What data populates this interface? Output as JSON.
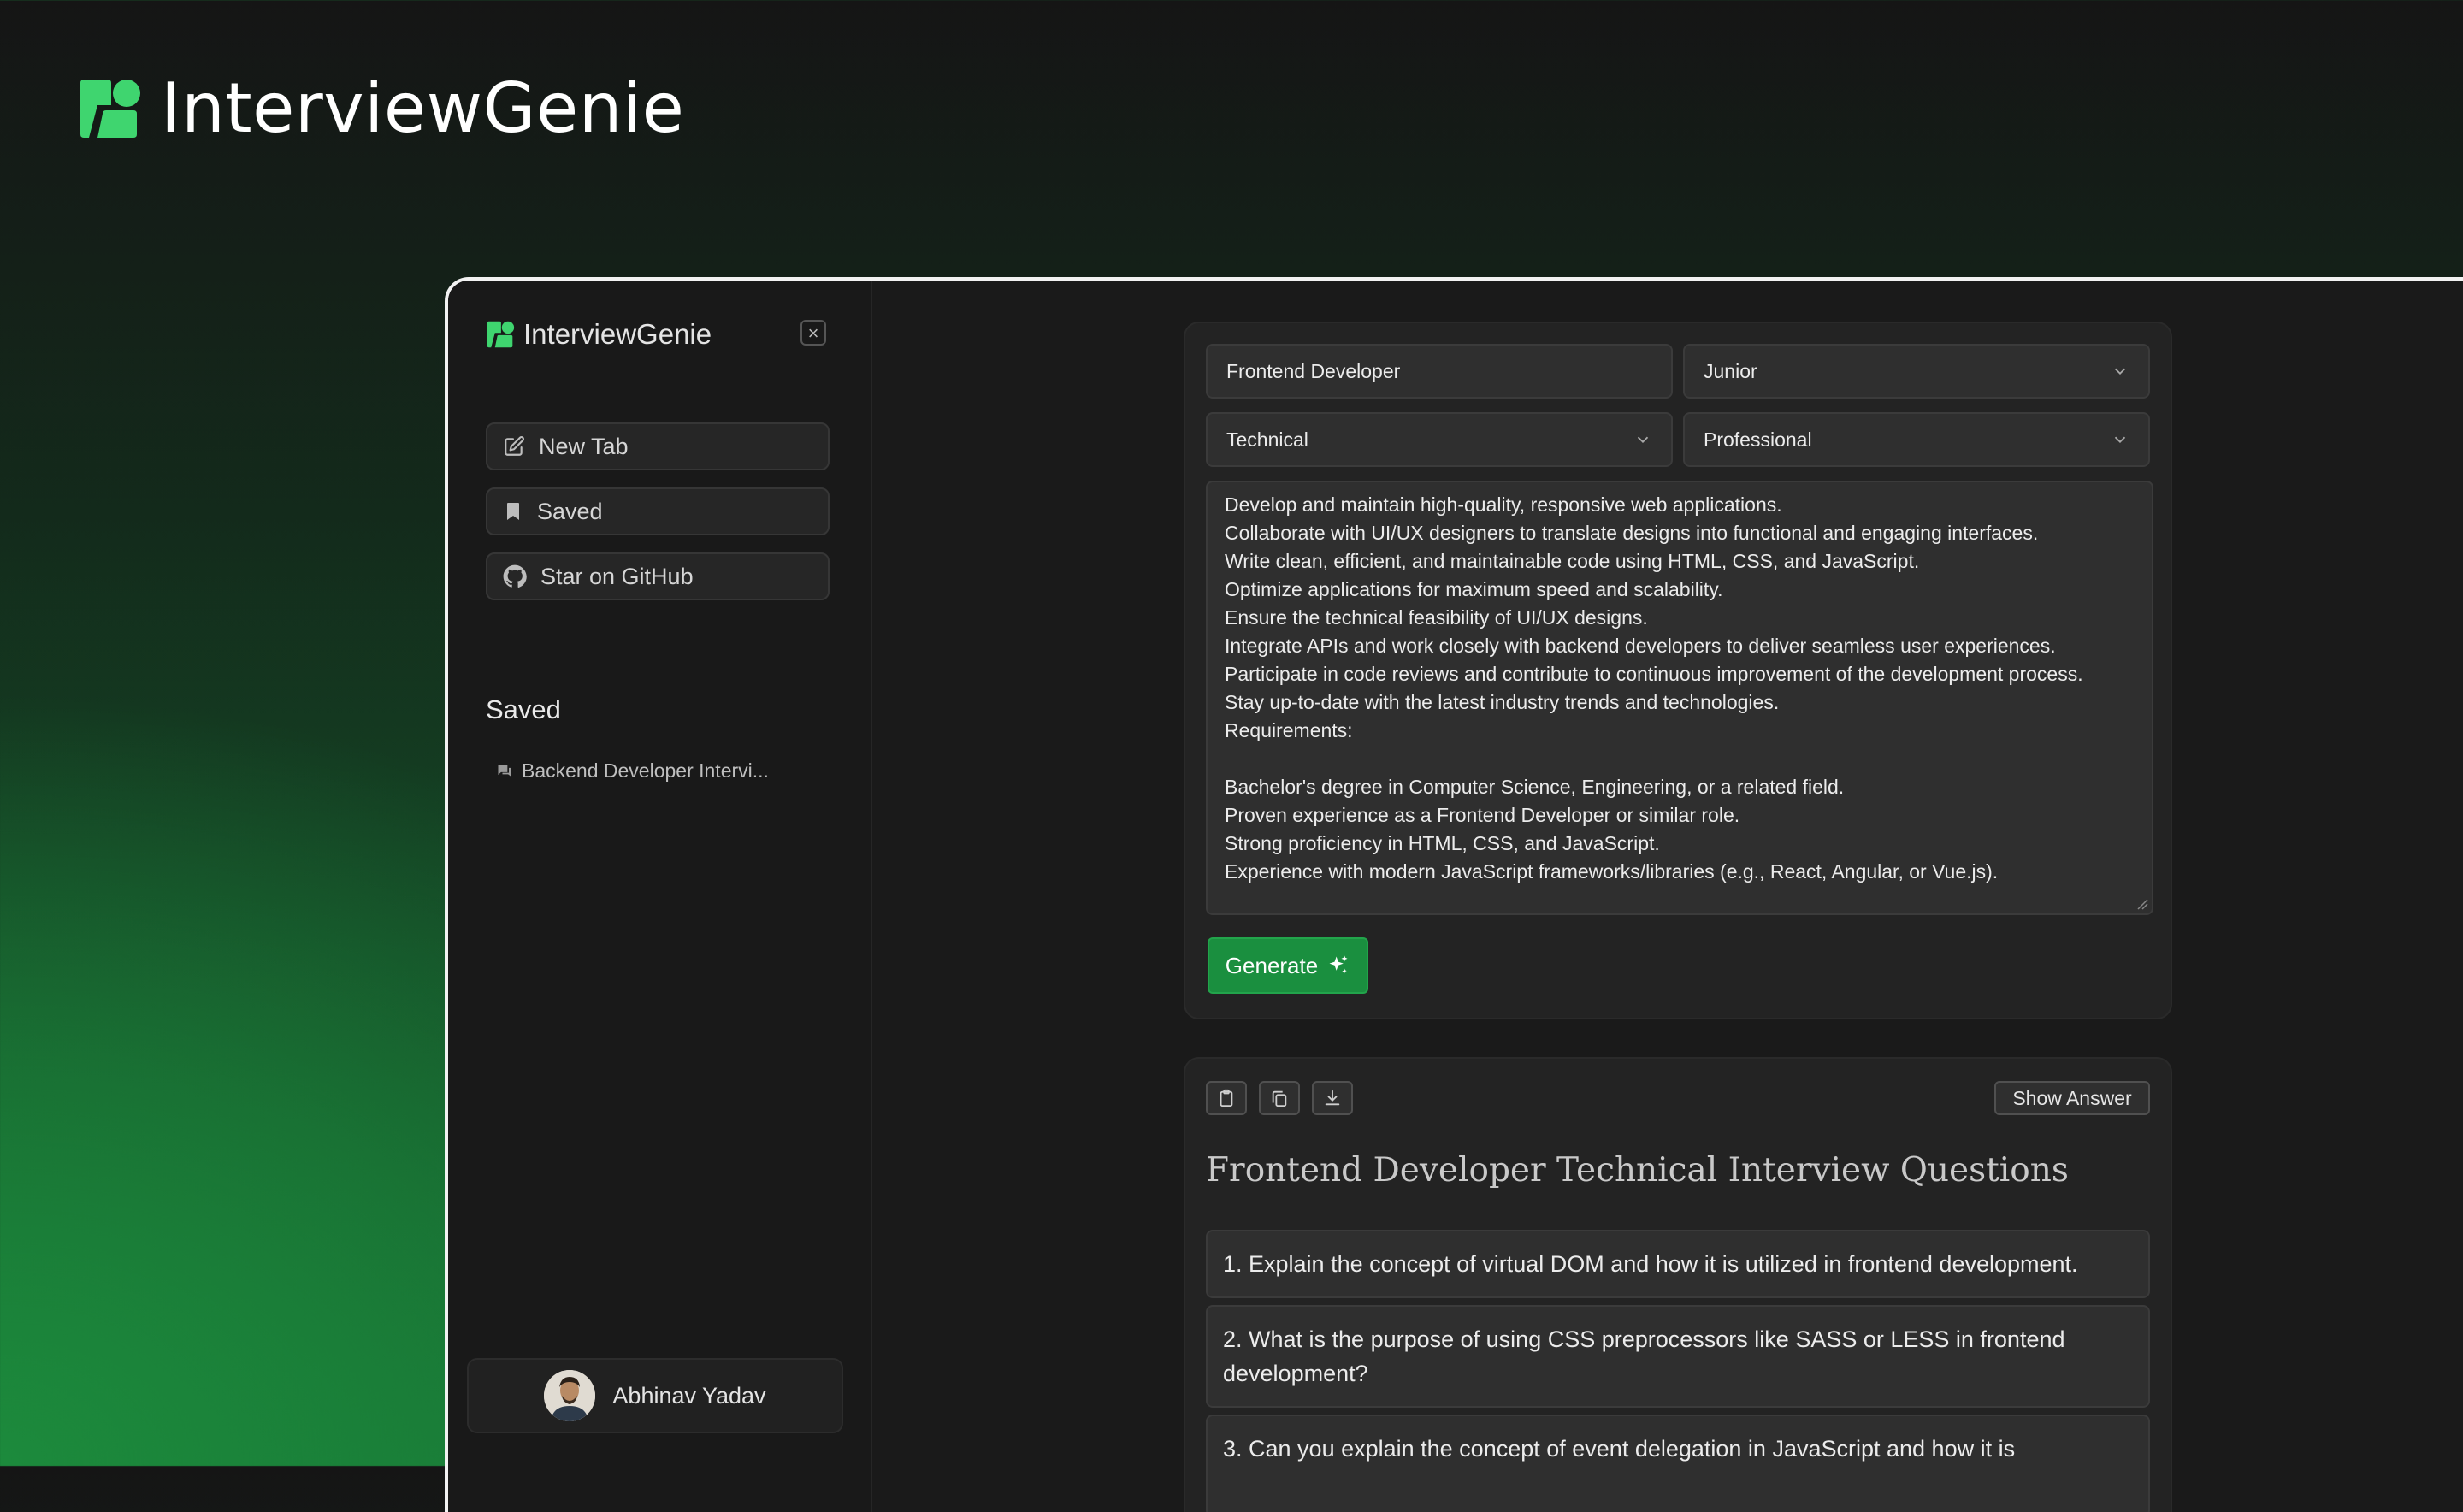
{
  "hero": {
    "brand": "InterviewGenie",
    "logo_icon": "genie-logo-icon",
    "accent": "#3fd56f"
  },
  "sidebar": {
    "brand": "InterviewGenie",
    "close_icon": "close-icon",
    "buttons": [
      {
        "label": "New Tab",
        "icon": "edit-icon"
      },
      {
        "label": "Saved",
        "icon": "bookmark-icon"
      },
      {
        "label": "Star on GitHub",
        "icon": "github-icon"
      }
    ],
    "saved_heading": "Saved",
    "saved_items": [
      {
        "label": "Backend Developer Intervi...",
        "icon": "chat-icon"
      }
    ],
    "user": {
      "name": "Abhinav Yadav"
    }
  },
  "form": {
    "role": "Frontend Developer",
    "level": "Junior",
    "type": "Technical",
    "tone": "Professional",
    "description": "Develop and maintain high-quality, responsive web applications.\nCollaborate with UI/UX designers to translate designs into functional and engaging interfaces.\nWrite clean, efficient, and maintainable code using HTML, CSS, and JavaScript.\nOptimize applications for maximum speed and scalability.\nEnsure the technical feasibility of UI/UX designs.\nIntegrate APIs and work closely with backend developers to deliver seamless user experiences.\nParticipate in code reviews and contribute to continuous improvement of the development process.\nStay up-to-date with the latest industry trends and technologies.\nRequirements:\n\nBachelor's degree in Computer Science, Engineering, or a related field.\nProven experience as a Frontend Developer or similar role.\nStrong proficiency in HTML, CSS, and JavaScript.\nExperience with modern JavaScript frameworks/libraries (e.g., React, Angular, or Vue.js).",
    "generate_label": "Generate",
    "generate_color": "#1a8f3f"
  },
  "results": {
    "toolbar_icons": [
      "clipboard-icon",
      "copy-icon",
      "download-icon"
    ],
    "show_answer_label": "Show Answer",
    "title": "Frontend Developer Technical Interview Questions",
    "questions": [
      "1. Explain the concept of virtual DOM and how it is utilized in frontend development.",
      "2. What is the purpose of using CSS preprocessors like SASS or LESS in frontend development?",
      "3. Can you explain the concept of event delegation in JavaScript and how it is"
    ]
  }
}
